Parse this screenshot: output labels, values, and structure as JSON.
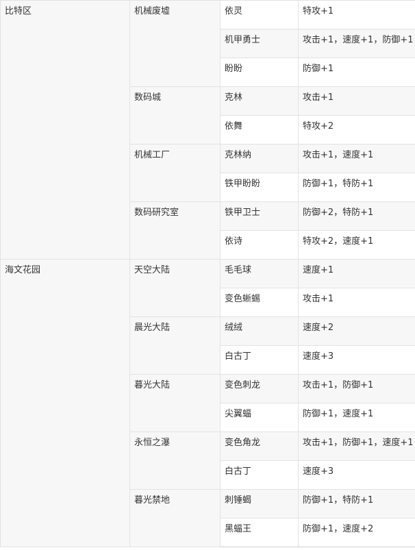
{
  "table": {
    "rows": [
      {
        "region": "比特区",
        "region_rowspan": 9,
        "area": "机械废墟",
        "area_rowspan": 3,
        "pet": "依灵",
        "reward": "特攻+1"
      },
      {
        "pet": "机甲勇士",
        "reward": "攻击+1，速度+1，防御+1"
      },
      {
        "pet": "盼盼",
        "reward": "防御+1"
      },
      {
        "area": "数码城",
        "area_rowspan": 2,
        "pet": "克林",
        "reward": "攻击+1"
      },
      {
        "pet": "依舞",
        "reward": "特攻+2"
      },
      {
        "area": "机械工厂",
        "area_rowspan": 2,
        "pet": "克林纳",
        "reward": "攻击+1，速度+1"
      },
      {
        "pet": "铁甲盼盼",
        "reward": "防御+1，特防+1"
      },
      {
        "area": "数码研究室",
        "area_rowspan": 2,
        "pet": "铁甲卫士",
        "reward": "防御+2，特防+1"
      },
      {
        "pet": "依诗",
        "reward": "特攻+2，速度+1"
      },
      {
        "region": "海文花园",
        "region_rowspan": 10,
        "area": "天空大陆",
        "area_rowspan": 2,
        "pet": "毛毛球",
        "reward": "速度+1"
      },
      {
        "pet": "变色蜥蜴",
        "reward": "攻击+1"
      },
      {
        "area": "晨光大陆",
        "area_rowspan": 2,
        "pet": "绒绒",
        "reward": "速度+2"
      },
      {
        "pet": "白古丁",
        "reward": "速度+3"
      },
      {
        "area": "暮光大陆",
        "area_rowspan": 2,
        "pet": "变色刺龙",
        "reward": "攻击+1，防御+1"
      },
      {
        "pet": "尖翼蝠",
        "reward": "防御+1，速度+1"
      },
      {
        "area": "永恒之瀑",
        "area_rowspan": 2,
        "pet": "变色角龙",
        "reward": "攻击+1，防御+1，速度+1"
      },
      {
        "pet": "白古丁",
        "reward": "速度+3"
      },
      {
        "area": "暮光禁地",
        "area_rowspan": 2,
        "pet": "刺锤蝎",
        "reward": "防御+1，特防+1"
      },
      {
        "pet": "黑蝠王",
        "reward": "防御+1，速度+2"
      }
    ]
  }
}
